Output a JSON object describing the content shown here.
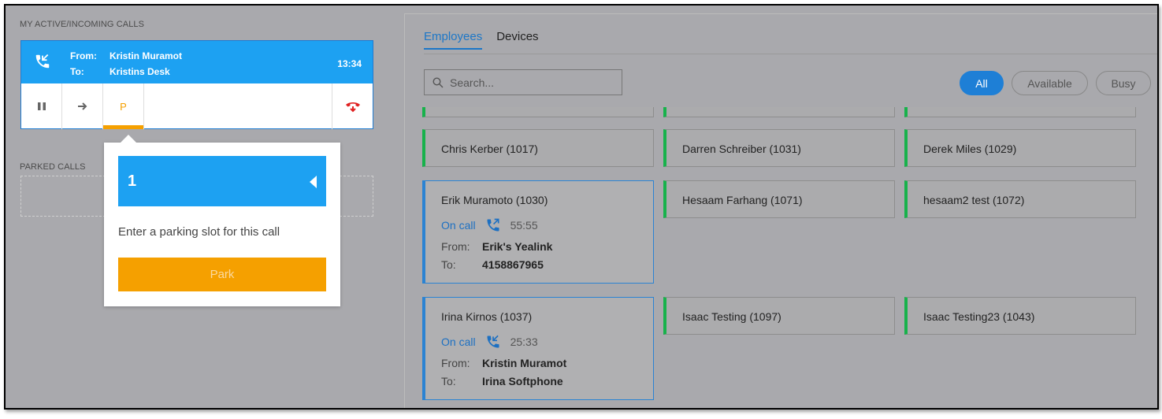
{
  "left": {
    "active_title": "MY ACTIVE/INCOMING CALLS",
    "parked_title": "PARKED CALLS",
    "call": {
      "from_label": "From:",
      "from_value": "Kristin Muramot",
      "to_label": "To:",
      "to_value": "Kristins Desk",
      "time": "13:34",
      "park_label": "P"
    },
    "popover": {
      "slot_value": "1",
      "instruction": "Enter a parking slot for this call",
      "park_button": "Park"
    }
  },
  "right": {
    "tabs": [
      "Employees",
      "Devices"
    ],
    "search_placeholder": "Search...",
    "filters": [
      "All",
      "Available",
      "Busy"
    ],
    "employees": [
      {
        "name": "Chris Kerber (1017)"
      },
      {
        "name": "Darren Schreiber (1031)"
      },
      {
        "name": "Derek Miles (1029)"
      },
      {
        "name": "Erik Muramoto (1030)",
        "status": "On call",
        "duration": "55:55",
        "from_label": "From:",
        "from": "Erik's Yealink",
        "to_label": "To:",
        "to": "4158867965"
      },
      {
        "name": "Hesaam Farhang (1071)"
      },
      {
        "name": "hesaam2 test (1072)"
      },
      {
        "name": "Irina Kirnos (1037)",
        "status": "On call",
        "duration": "25:33",
        "from_label": "From:",
        "from": "Kristin Muramot",
        "to_label": "To:",
        "to": "Irina Softphone"
      },
      {
        "name": "Isaac Testing (1097)"
      },
      {
        "name": "Isaac Testing23 (1043)"
      }
    ]
  },
  "colors": {
    "accent": "#1da1f2",
    "park": "#f5a000",
    "available": "#17b24b",
    "hangup": "#e02020"
  }
}
